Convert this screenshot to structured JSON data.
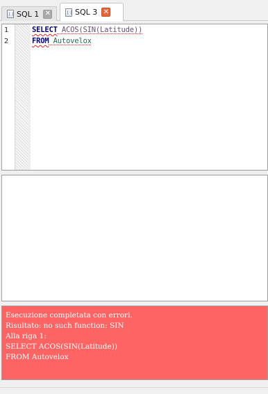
{
  "tabs": [
    {
      "label": "SQL 1",
      "close_icon": "close-icon",
      "active": false
    },
    {
      "label": "SQL 3",
      "close_icon": "close-icon",
      "active": true
    }
  ],
  "editor": {
    "line_numbers": [
      "1",
      "2"
    ],
    "lines": [
      {
        "keyword": "SELECT",
        "rest": " ACOS(SIN(Latitude))"
      },
      {
        "keyword": "FROM",
        "rest": " Autovelox"
      }
    ]
  },
  "error": {
    "lines": [
      "Esecuzione completata con errori.",
      "Risultato: no such function: SIN",
      "Alla riga 1:",
      "SELECT ACOS(SIN(Latitude))",
      "FROM Autovelox"
    ],
    "background": "#fe6464"
  },
  "colors": {
    "keyword": "#00007f",
    "active_close": "#e8663e",
    "inactive_close": "#a9a9a9"
  }
}
